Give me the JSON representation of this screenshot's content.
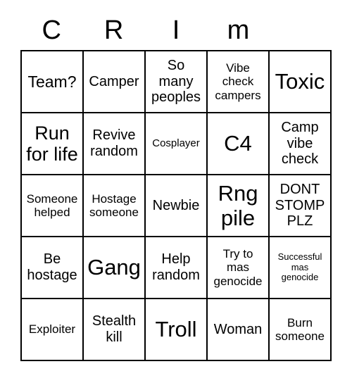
{
  "card": {
    "title": "CRIm",
    "header_letters": [
      "C",
      "R",
      "I",
      "m",
      ""
    ],
    "grid_size": "5x5",
    "colors": {
      "border": "#000000",
      "background": "#ffffff",
      "text": "#000000"
    },
    "rows": [
      [
        {
          "text": "Team?",
          "size": "lg"
        },
        {
          "text": "Camper",
          "size": "md"
        },
        {
          "text": "So many peoples",
          "size": "md"
        },
        {
          "text": "Vibe check campers",
          "size": "sm"
        },
        {
          "text": "Toxic",
          "size": "xxl"
        }
      ],
      [
        {
          "text": "Run for life",
          "size": "xl"
        },
        {
          "text": "Revive random",
          "size": "md"
        },
        {
          "text": "Cosplayer",
          "size": "xs"
        },
        {
          "text": "C4",
          "size": "xxl"
        },
        {
          "text": "Camp vibe check",
          "size": "md"
        }
      ],
      [
        {
          "text": "Someone helped",
          "size": "sm"
        },
        {
          "text": "Hostage someone",
          "size": "sm"
        },
        {
          "text": "Newbie",
          "size": "md"
        },
        {
          "text": "Rng pile",
          "size": "xxl"
        },
        {
          "text": "DONT STOMP PLZ",
          "size": "md"
        }
      ],
      [
        {
          "text": "Be hostage",
          "size": "md"
        },
        {
          "text": "Gang",
          "size": "xxl"
        },
        {
          "text": "Help random",
          "size": "md"
        },
        {
          "text": "Try to mas genocide",
          "size": "sm"
        },
        {
          "text": "Successful mas genocide",
          "size": "xxs"
        }
      ],
      [
        {
          "text": "Exploiter",
          "size": "sm"
        },
        {
          "text": "Stealth kill",
          "size": "md"
        },
        {
          "text": "Troll",
          "size": "xxl"
        },
        {
          "text": "Woman",
          "size": "md"
        },
        {
          "text": "Burn someone",
          "size": "sm"
        }
      ]
    ]
  }
}
